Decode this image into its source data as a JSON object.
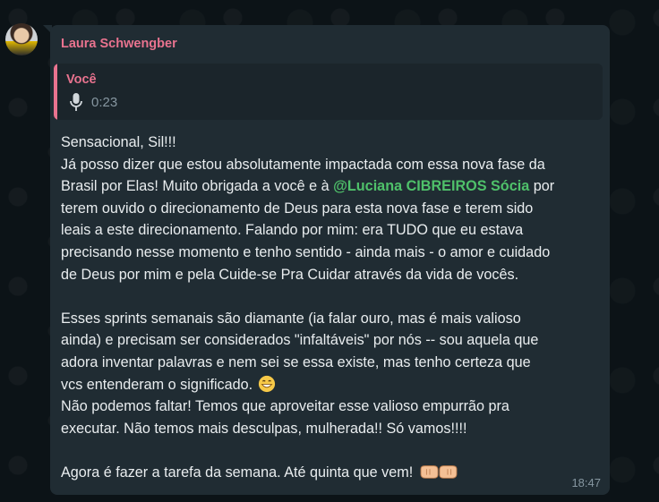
{
  "chat": {
    "sender_name": "Laura Schwengber",
    "reply": {
      "author": "Você",
      "media_icon": "mic-icon",
      "duration": "0:23"
    },
    "message": {
      "p1_l1": "Sensacional, Sil!!!",
      "p1_l2": "Já posso dizer que estou absolutamente impactada com essa nova fase da",
      "p1_l3a": "Brasil por Elas! Muito obrigada a você e à ",
      "mention": "@Luciana CIBREIROS Sócia",
      "p1_l3b": " por",
      "p1_l4": "terem ouvido o direcionamento de Deus para esta nova fase e terem sido",
      "p1_l5": "leais a este direcionamento. Falando por mim: era TUDO que eu estava",
      "p1_l6": "precisando nesse momento e tenho sentido - ainda mais - o amor e cuidado",
      "p1_l7": "de Deus por mim e pela Cuide-se Pra Cuidar através da vida de vocês.",
      "p2_l1": "Esses sprints semanais são diamante (ia falar ouro, mas é mais valioso",
      "p2_l2": "ainda) e precisam ser considerados \"infaltáveis\" por nós -- sou aquela que",
      "p2_l3": "adora inventar palavras e nem sei se essa existe, mas tenho certeza que",
      "p2_l4": "vcs entenderam o significado. ",
      "p2_l5": "Não podemos faltar! Temos que aproveitar esse valioso empurrão pra",
      "p2_l6": "executar. Não temos mais desculpas, mulherada!! Só vamos!!!!",
      "p3_l1": "Agora é fazer a tarefa da semana. Até quinta que vem! "
    },
    "emojis": [
      "grinning-face-icon",
      "fist-bump-icon"
    ],
    "timestamp": "18:47"
  },
  "colors": {
    "bubble": "#202c33",
    "sender": "#e9738f",
    "mention": "#4fc16a",
    "text": "#e9edef",
    "meta": "#8696a0"
  }
}
